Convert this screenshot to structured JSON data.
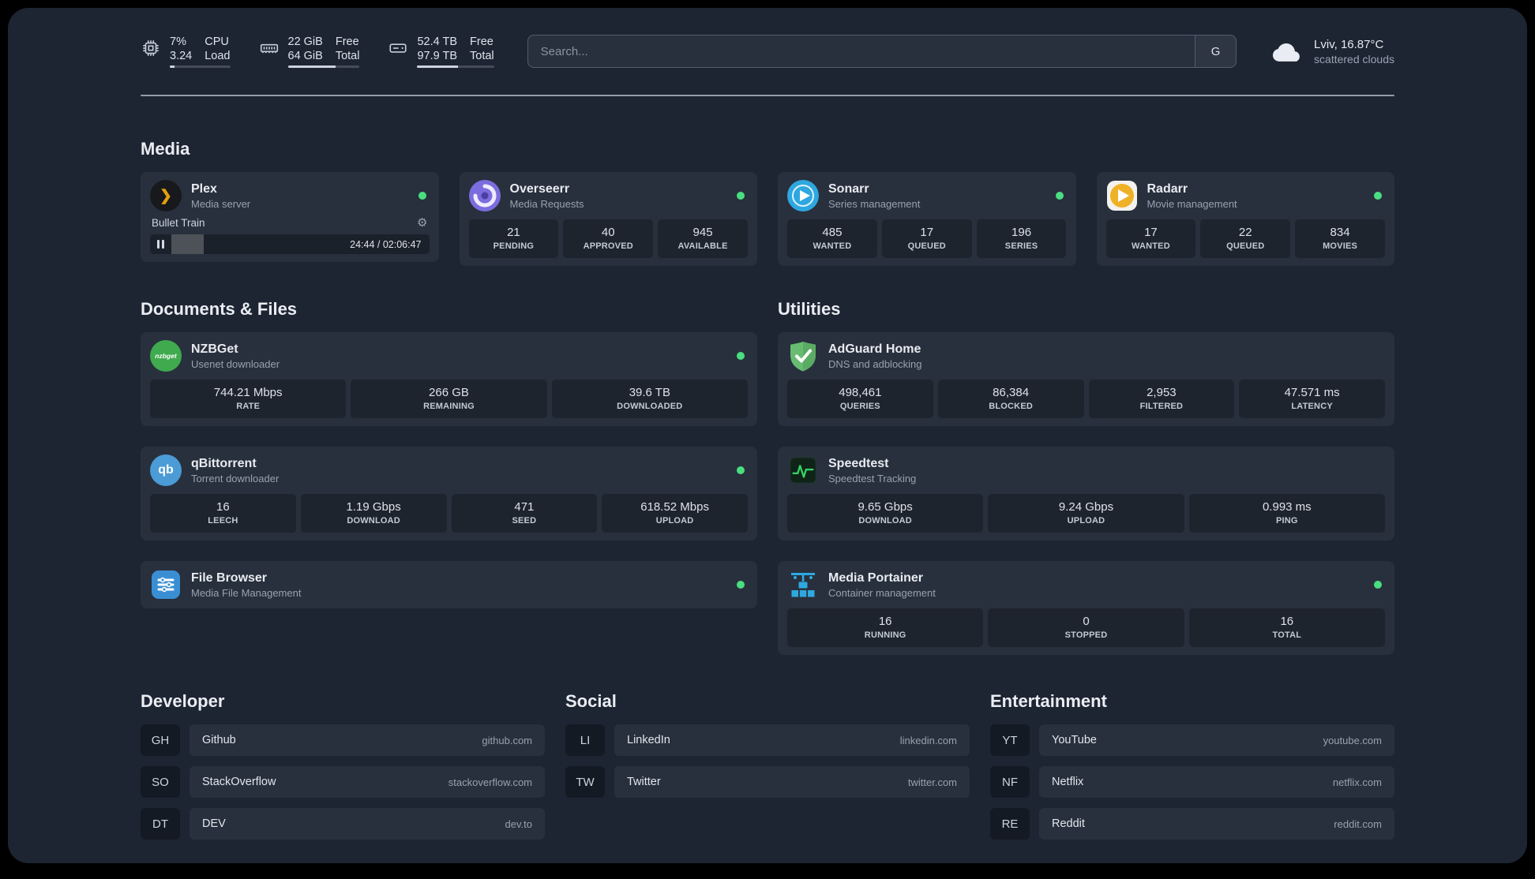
{
  "topbar": {
    "cpu": {
      "value_top": "7%",
      "value_bottom": "3.24",
      "label_top": "CPU",
      "label_bottom": "Load",
      "progress_pct": 8
    },
    "memory": {
      "value_top": "22 GiB",
      "value_bottom": "64 GiB",
      "label_top": "Free",
      "label_bottom": "Total",
      "progress_pct": 66
    },
    "disk": {
      "value_top": "52.4 TB",
      "value_bottom": "97.9 TB",
      "label_top": "Free",
      "label_bottom": "Total",
      "progress_pct": 53
    },
    "search": {
      "placeholder": "Search...",
      "provider_label": "G"
    },
    "weather": {
      "location": "Lviv, 16.87°C",
      "condition": "scattered clouds"
    }
  },
  "icons": {
    "plex_glyph": "❯",
    "qbittorrent_text": "qb",
    "nzbget_text": "nzbget",
    "gear_glyph": "⚙"
  },
  "colors": {
    "status_online": "#4ade80"
  },
  "sections": {
    "media": {
      "title": "Media",
      "cards": [
        {
          "name": "Plex",
          "desc": "Media server",
          "player": {
            "track": "Bullet Train",
            "time": "24:44 / 02:06:47",
            "progress_pct": 19
          }
        },
        {
          "name": "Overseerr",
          "desc": "Media Requests",
          "stats": [
            {
              "value": "21",
              "label": "PENDING"
            },
            {
              "value": "40",
              "label": "APPROVED"
            },
            {
              "value": "945",
              "label": "AVAILABLE"
            }
          ]
        },
        {
          "name": "Sonarr",
          "desc": "Series management",
          "stats": [
            {
              "value": "485",
              "label": "WANTED"
            },
            {
              "value": "17",
              "label": "QUEUED"
            },
            {
              "value": "196",
              "label": "SERIES"
            }
          ]
        },
        {
          "name": "Radarr",
          "desc": "Movie management",
          "stats": [
            {
              "value": "17",
              "label": "WANTED"
            },
            {
              "value": "22",
              "label": "QUEUED"
            },
            {
              "value": "834",
              "label": "MOVIES"
            }
          ]
        }
      ]
    },
    "documents": {
      "title": "Documents & Files",
      "cards": [
        {
          "name": "NZBGet",
          "desc": "Usenet downloader",
          "stats": [
            {
              "value": "744.21 Mbps",
              "label": "RATE"
            },
            {
              "value": "266 GB",
              "label": "REMAINING"
            },
            {
              "value": "39.6 TB",
              "label": "DOWNLOADED"
            }
          ]
        },
        {
          "name": "qBittorrent",
          "desc": "Torrent downloader",
          "stats": [
            {
              "value": "16",
              "label": "LEECH"
            },
            {
              "value": "1.19 Gbps",
              "label": "DOWNLOAD"
            },
            {
              "value": "471",
              "label": "SEED"
            },
            {
              "value": "618.52 Mbps",
              "label": "UPLOAD"
            }
          ]
        },
        {
          "name": "File Browser",
          "desc": "Media File Management"
        }
      ]
    },
    "utilities": {
      "title": "Utilities",
      "cards": [
        {
          "name": "AdGuard Home",
          "desc": "DNS and adblocking",
          "stats": [
            {
              "value": "498,461",
              "label": "QUERIES"
            },
            {
              "value": "86,384",
              "label": "BLOCKED"
            },
            {
              "value": "2,953",
              "label": "FILTERED"
            },
            {
              "value": "47.571 ms",
              "label": "LATENCY"
            }
          ]
        },
        {
          "name": "Speedtest",
          "desc": "Speedtest Tracking",
          "stats": [
            {
              "value": "9.65 Gbps",
              "label": "DOWNLOAD"
            },
            {
              "value": "9.24 Gbps",
              "label": "UPLOAD"
            },
            {
              "value": "0.993 ms",
              "label": "PING"
            }
          ]
        },
        {
          "name": "Media Portainer",
          "desc": "Container management",
          "stats": [
            {
              "value": "16",
              "label": "RUNNING"
            },
            {
              "value": "0",
              "label": "STOPPED"
            },
            {
              "value": "16",
              "label": "TOTAL"
            }
          ]
        }
      ]
    }
  },
  "bookmarks": [
    {
      "title": "Developer",
      "items": [
        {
          "abbr": "GH",
          "name": "Github",
          "domain": "github.com"
        },
        {
          "abbr": "SO",
          "name": "StackOverflow",
          "domain": "stackoverflow.com"
        },
        {
          "abbr": "DT",
          "name": "DEV",
          "domain": "dev.to"
        }
      ]
    },
    {
      "title": "Social",
      "items": [
        {
          "abbr": "LI",
          "name": "LinkedIn",
          "domain": "linkedin.com"
        },
        {
          "abbr": "TW",
          "name": "Twitter",
          "domain": "twitter.com"
        }
      ]
    },
    {
      "title": "Entertainment",
      "items": [
        {
          "abbr": "YT",
          "name": "YouTube",
          "domain": "youtube.com"
        },
        {
          "abbr": "NF",
          "name": "Netflix",
          "domain": "netflix.com"
        },
        {
          "abbr": "RE",
          "name": "Reddit",
          "domain": "reddit.com"
        }
      ]
    }
  ]
}
